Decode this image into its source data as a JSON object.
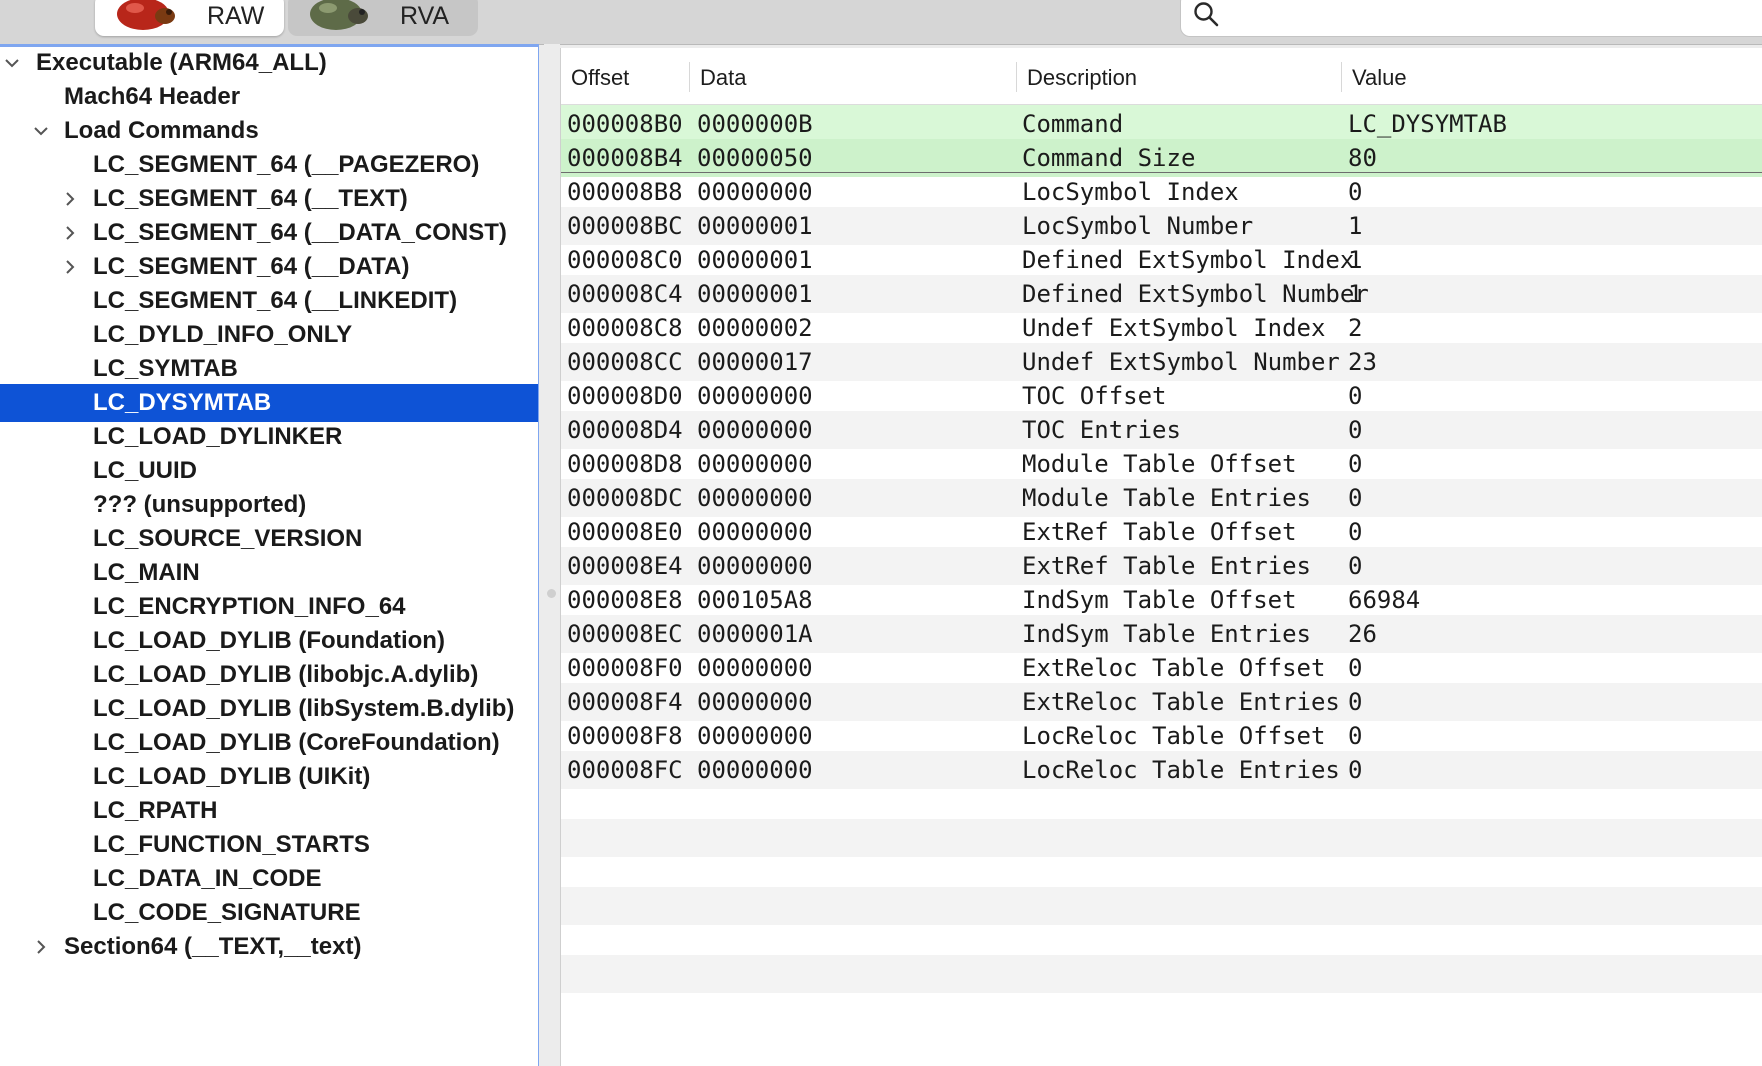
{
  "toolbar": {
    "raw_label": "RAW",
    "rva_label": "RVA",
    "raw_icon": "raw-mode-icon",
    "rva_icon": "rva-mode-icon",
    "search_icon": "search-icon",
    "search_value": ""
  },
  "tree": {
    "items": [
      {
        "label": "Executable  (ARM64_ALL)",
        "chevron": "down",
        "depth": 0
      },
      {
        "label": "Mach64 Header",
        "chevron": "none",
        "depth": 1
      },
      {
        "label": "Load Commands",
        "chevron": "down",
        "depth": 1
      },
      {
        "label": "LC_SEGMENT_64 (__PAGEZERO)",
        "chevron": "none",
        "depth": 2
      },
      {
        "label": "LC_SEGMENT_64 (__TEXT)",
        "chevron": "right",
        "depth": 2
      },
      {
        "label": "LC_SEGMENT_64 (__DATA_CONST)",
        "chevron": "right",
        "depth": 2
      },
      {
        "label": "LC_SEGMENT_64 (__DATA)",
        "chevron": "right",
        "depth": 2
      },
      {
        "label": "LC_SEGMENT_64 (__LINKEDIT)",
        "chevron": "none",
        "depth": 2
      },
      {
        "label": "LC_DYLD_INFO_ONLY",
        "chevron": "none",
        "depth": 2
      },
      {
        "label": "LC_SYMTAB",
        "chevron": "none",
        "depth": 2
      },
      {
        "label": "LC_DYSYMTAB",
        "chevron": "none",
        "depth": 2,
        "selected": true
      },
      {
        "label": "LC_LOAD_DYLINKER",
        "chevron": "none",
        "depth": 2
      },
      {
        "label": "LC_UUID",
        "chevron": "none",
        "depth": 2
      },
      {
        "label": "??? (unsupported)",
        "chevron": "none",
        "depth": 2
      },
      {
        "label": "LC_SOURCE_VERSION",
        "chevron": "none",
        "depth": 2
      },
      {
        "label": "LC_MAIN",
        "chevron": "none",
        "depth": 2
      },
      {
        "label": "LC_ENCRYPTION_INFO_64",
        "chevron": "none",
        "depth": 2
      },
      {
        "label": "LC_LOAD_DYLIB (Foundation)",
        "chevron": "none",
        "depth": 2
      },
      {
        "label": "LC_LOAD_DYLIB (libobjc.A.dylib)",
        "chevron": "none",
        "depth": 2
      },
      {
        "label": "LC_LOAD_DYLIB (libSystem.B.dylib)",
        "chevron": "none",
        "depth": 2
      },
      {
        "label": "LC_LOAD_DYLIB (CoreFoundation)",
        "chevron": "none",
        "depth": 2
      },
      {
        "label": "LC_LOAD_DYLIB (UIKit)",
        "chevron": "none",
        "depth": 2
      },
      {
        "label": "LC_RPATH",
        "chevron": "none",
        "depth": 2
      },
      {
        "label": "LC_FUNCTION_STARTS",
        "chevron": "none",
        "depth": 2
      },
      {
        "label": "LC_DATA_IN_CODE",
        "chevron": "none",
        "depth": 2
      },
      {
        "label": "LC_CODE_SIGNATURE",
        "chevron": "none",
        "depth": 2
      },
      {
        "label": "Section64 (__TEXT,__text)",
        "chevron": "right",
        "depth": 1
      }
    ]
  },
  "table": {
    "columns": [
      "Offset",
      "Data",
      "Description",
      "Value"
    ],
    "rows": [
      {
        "offset": "000008B0",
        "data": "0000000B",
        "description": "Command",
        "value": "LC_DYSYMTAB",
        "highlight": true
      },
      {
        "offset": "000008B4",
        "data": "00000050",
        "description": "Command Size",
        "value": "80",
        "highlight": true
      },
      {
        "offset": "000008B8",
        "data": "00000000",
        "description": "LocSymbol Index",
        "value": "0"
      },
      {
        "offset": "000008BC",
        "data": "00000001",
        "description": "LocSymbol Number",
        "value": "1"
      },
      {
        "offset": "000008C0",
        "data": "00000001",
        "description": "Defined ExtSymbol Index",
        "value": "1"
      },
      {
        "offset": "000008C4",
        "data": "00000001",
        "description": "Defined ExtSymbol Number",
        "value": "1"
      },
      {
        "offset": "000008C8",
        "data": "00000002",
        "description": "Undef ExtSymbol Index",
        "value": "2"
      },
      {
        "offset": "000008CC",
        "data": "00000017",
        "description": "Undef ExtSymbol Number",
        "value": "23"
      },
      {
        "offset": "000008D0",
        "data": "00000000",
        "description": "TOC Offset",
        "value": "0"
      },
      {
        "offset": "000008D4",
        "data": "00000000",
        "description": "TOC Entries",
        "value": "0"
      },
      {
        "offset": "000008D8",
        "data": "00000000",
        "description": "Module Table Offset",
        "value": "0"
      },
      {
        "offset": "000008DC",
        "data": "00000000",
        "description": "Module Table Entries",
        "value": "0"
      },
      {
        "offset": "000008E0",
        "data": "00000000",
        "description": "ExtRef Table Offset",
        "value": "0"
      },
      {
        "offset": "000008E4",
        "data": "00000000",
        "description": "ExtRef Table Entries",
        "value": "0"
      },
      {
        "offset": "000008E8",
        "data": "000105A8",
        "description": "IndSym Table Offset",
        "value": "66984"
      },
      {
        "offset": "000008EC",
        "data": "0000001A",
        "description": "IndSym Table Entries",
        "value": "26"
      },
      {
        "offset": "000008F0",
        "data": "00000000",
        "description": "ExtReloc Table Offset",
        "value": "0"
      },
      {
        "offset": "000008F4",
        "data": "00000000",
        "description": "ExtReloc Table Entries",
        "value": "0"
      },
      {
        "offset": "000008F8",
        "data": "00000000",
        "description": "LocReloc Table Offset",
        "value": "0"
      },
      {
        "offset": "000008FC",
        "data": "00000000",
        "description": "LocReloc Table Entries",
        "value": "0"
      }
    ]
  },
  "colors": {
    "selection": "#0e53d6",
    "highlight_row": "#d9f8d7",
    "focus_ring": "#7fa6f0"
  }
}
